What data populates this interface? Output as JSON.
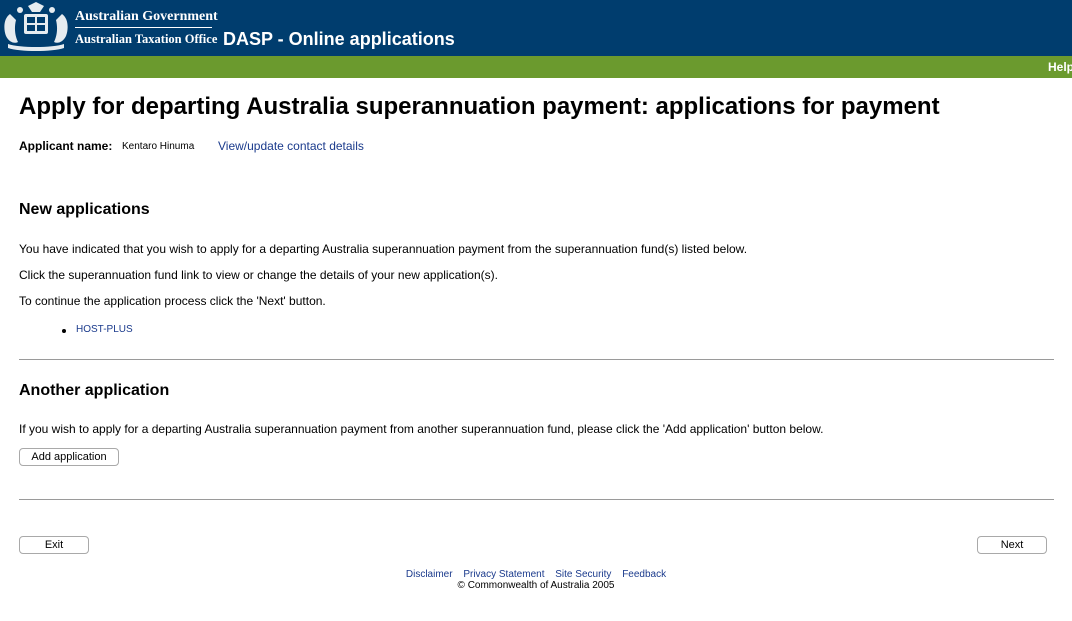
{
  "header": {
    "government": "Australian Government",
    "office": "Australian Taxation Office",
    "app_title": "DASP - Online applications",
    "crest_icon": "coat-of-arms-icon",
    "colors": {
      "header_bg": "#003d6e",
      "nav_bar": "#6b9a2e",
      "link": "#1a3a8c"
    }
  },
  "nav": {
    "help": "Help"
  },
  "page": {
    "title": "Apply for departing Australia superannuation payment: applications for payment",
    "applicant_label": "Applicant name:",
    "applicant_value": "Kentaro Hinuma",
    "contact_link": "View/update contact details"
  },
  "new_applications": {
    "heading": "New applications",
    "para1": "You have indicated that you wish to apply for a departing Australia superannuation payment from the superannuation fund(s) listed below.",
    "para2": "Click the superannuation fund link to view or change the details of your new application(s).",
    "para3": "To continue the application process click the 'Next' button.",
    "funds": [
      "HOST-PLUS"
    ]
  },
  "another_application": {
    "heading": "Another application",
    "text": "If you wish to apply for a departing Australia superannuation payment from another superannuation fund, please click the 'Add application' button below.",
    "button": "Add application"
  },
  "actions": {
    "exit": "Exit",
    "next": "Next"
  },
  "footer": {
    "links": [
      "Disclaimer",
      "Privacy Statement",
      "Site Security",
      "Feedback"
    ],
    "copyright": "© Commonwealth of Australia 2005"
  }
}
